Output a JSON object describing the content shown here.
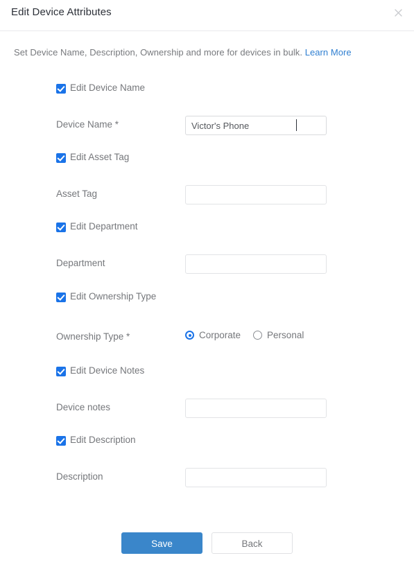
{
  "dialog": {
    "title": "Edit Device Attributes",
    "close_icon": "close-icon",
    "subtitle_text": "Set Device Name, Description, Ownership and more for devices in bulk.",
    "subtitle_link": "Learn More"
  },
  "fields": [
    {
      "toggle_label": "Edit Device Name",
      "toggle_checked": true,
      "label": "Device Name *",
      "type": "text",
      "value": "Victor's Phone",
      "placeholder": "",
      "focused": true
    },
    {
      "toggle_label": "Edit Asset Tag",
      "toggle_checked": true,
      "label": "Asset Tag",
      "type": "text",
      "value": "",
      "placeholder": "",
      "focused": false
    },
    {
      "toggle_label": "Edit Department",
      "toggle_checked": true,
      "label": "Department",
      "type": "text",
      "value": "",
      "placeholder": "",
      "focused": false
    },
    {
      "toggle_label": "Edit Ownership Type",
      "toggle_checked": true,
      "label": "Ownership Type *",
      "type": "radio",
      "options": [
        {
          "label": "Corporate",
          "selected": true
        },
        {
          "label": "Personal",
          "selected": false
        }
      ]
    },
    {
      "toggle_label": "Edit Device Notes",
      "toggle_checked": true,
      "label": "Device notes",
      "type": "text",
      "value": "",
      "placeholder": "",
      "focused": false
    },
    {
      "toggle_label": "Edit Description",
      "toggle_checked": true,
      "label": "Description",
      "type": "text",
      "value": "",
      "placeholder": "",
      "focused": false
    }
  ],
  "footer": {
    "save_label": "Save",
    "back_label": "Back"
  },
  "colors": {
    "checkbox_blue": "#1a73e8",
    "radio_blue": "#1a73e8",
    "primary_button": "#3a86ca",
    "link": "#2f7fd1",
    "label_gray": "#75777b",
    "title": "#2c3038"
  }
}
